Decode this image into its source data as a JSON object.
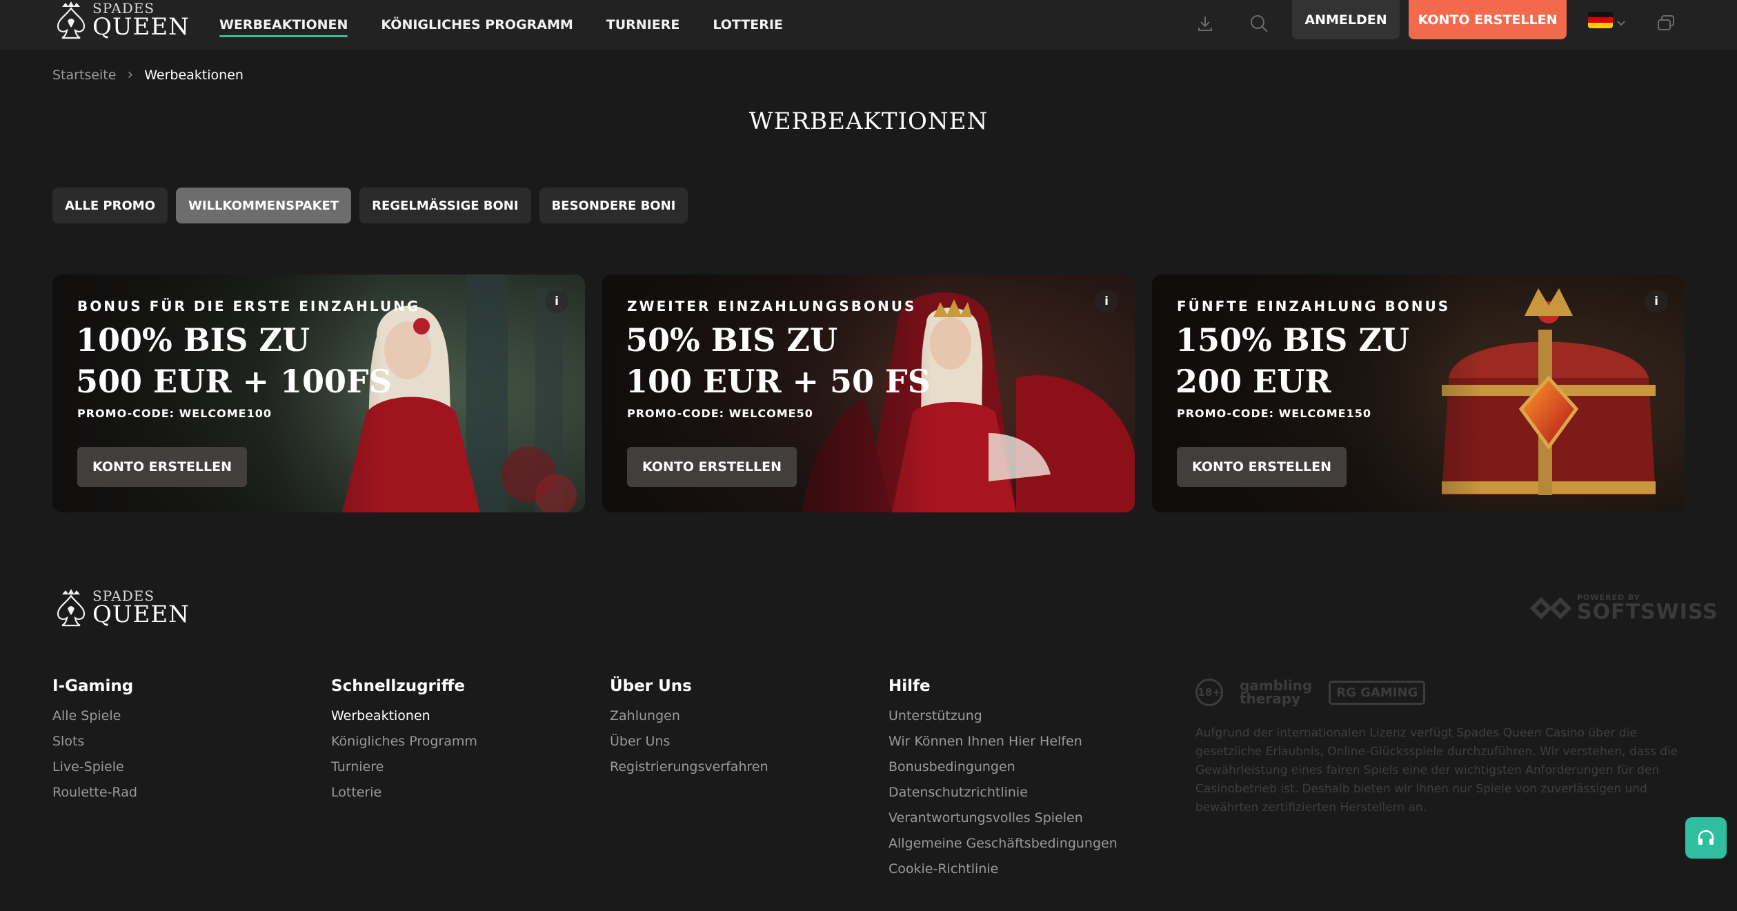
{
  "brand": {
    "top": "SPADES",
    "bottom": "QUEEN"
  },
  "nav": {
    "items": [
      {
        "label": "WERBEAKTIONEN"
      },
      {
        "label": "KÖNIGLICHES PROGRAMM"
      },
      {
        "label": "TURNIERE"
      },
      {
        "label": "LOTTERIE"
      }
    ]
  },
  "header": {
    "download_icon": "download-icon",
    "search_icon": "search-icon",
    "login_label": "ANMELDEN",
    "signup_label": "KONTO ERSTELLEN",
    "language_icon": "german-flag-icon",
    "chat_icon": "chat-icon"
  },
  "breadcrumb": {
    "home": "Startseite",
    "current": "Werbeaktionen"
  },
  "page_title": "WERBEAKTIONEN",
  "filters": [
    {
      "label": "ALLE PROMO"
    },
    {
      "label": "WILLKOMMENSPAKET",
      "active": true
    },
    {
      "label": "REGELMÄSSIGE BONI"
    },
    {
      "label": "BESONDERE BONI"
    }
  ],
  "promos": [
    {
      "eyebrow": "BONUS FÜR DIE ERSTE EINZAHLUNG",
      "line1": "100% BIS ZU",
      "line2": "500 EUR + 100FS",
      "promo_code": "PROMO-CODE: WELCOME100",
      "cta": "KONTO ERSTELLEN",
      "info": "i"
    },
    {
      "eyebrow": "ZWEITER EINZAHLUNGSBONUS",
      "line1": "50% BIS ZU",
      "line2": "100 EUR + 50 FS",
      "promo_code": "PROMO-CODE: WELCOME50",
      "cta": "KONTO ERSTELLEN",
      "info": "i"
    },
    {
      "eyebrow": "FÜNFTE EINZAHLUNG BONUS",
      "line1": "150% BIS ZU",
      "line2": "200 EUR",
      "promo_code": "PROMO-CODE: WELCOME150",
      "cta": "KONTO ERSTELLEN",
      "info": "i"
    }
  ],
  "footer": {
    "powered_by": "POWERED BY",
    "provider": "SOFTSWISS",
    "columns": [
      {
        "title": "I-Gaming",
        "links": [
          "Alle Spiele",
          "Slots",
          "Live-Spiele",
          "Roulette-Rad"
        ]
      },
      {
        "title": "Schnellzugriffe",
        "links": [
          "Werbeaktionen",
          "Königliches Programm",
          "Turniere",
          "Lotterie"
        ]
      },
      {
        "title": "Über Uns",
        "links": [
          "Zahlungen",
          "Über Uns",
          "Registrierungsverfahren"
        ]
      },
      {
        "title": "Hilfe",
        "links": [
          "Unterstützung",
          "Wir Können Ihnen Hier Helfen",
          "Bonusbedingungen",
          "Datenschutzrichtlinie",
          "Verantwortungsvolles Spielen",
          "Allgemeine Geschäftsbedingungen",
          "Cookie-Richtlinie"
        ]
      }
    ],
    "badges": {
      "age": "18+",
      "gt_line1": "gambling",
      "gt_line2": "therapy",
      "rg": "RG GAMING"
    },
    "disclaimer": "Aufgrund der internationalen Lizenz verfügt Spades Queen Casino über die gesetzliche Erlaubnis, Online-Glücksspiele durchzuführen. Wir verstehen, dass die Gewährleistung eines fairen Spiels eine der wichtigsten Anforderungen für den Casinobetrieb ist. Deshalb bieten wir Ihnen nur Spiele von zuverlässigen und bewährten zertifizierten Herstellern an.",
    "support_icon": "headset-icon"
  },
  "colors": {
    "accent": "#2fbfa0",
    "cta": "#f26a4b",
    "background": "#1a1a1a",
    "header": "#222222"
  }
}
